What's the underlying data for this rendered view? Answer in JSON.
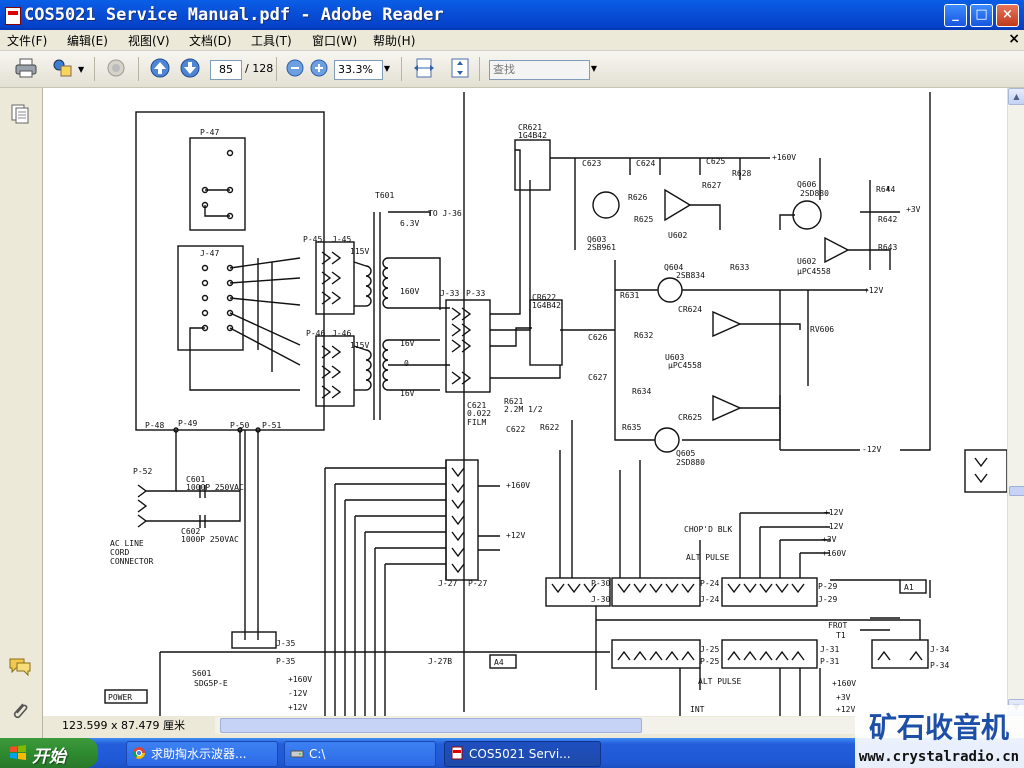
{
  "window": {
    "title": "COS5021 Service Manual.pdf - Adobe Reader",
    "buttons": {
      "minimize": "_",
      "maximize": "□",
      "close": "×"
    }
  },
  "menubar": {
    "items": [
      "文件(F)",
      "编辑(E)",
      "视图(V)",
      "文档(D)",
      "工具(T)",
      "窗口(W)",
      "帮助(H)"
    ],
    "close": "×"
  },
  "toolbar": {
    "page_current": "85",
    "page_total": "/ 128",
    "zoom": "33.3%",
    "find_placeholder": "查找"
  },
  "status": {
    "page_size": "123.599 x 87.479 厘米"
  },
  "schematic": {
    "labels": {
      "p47": "P-47",
      "j47": "J-47",
      "t601": "T601",
      "to_j36": "TO J-36",
      "v63": "6.3V",
      "p45": "P-45",
      "j45": "J-45",
      "p46": "P-46",
      "j46": "J-46",
      "v115a": "115V",
      "v115b": "115V",
      "v160": "160V",
      "v16a": "16V",
      "v0": "0",
      "v16b": "16V",
      "p48": "P-48",
      "p49": "P-49",
      "p50": "P-50",
      "p51": "P-51",
      "p52": "P-52",
      "c601": "C601",
      "c601v": "1000P 250VAC",
      "c602": "C602",
      "c602v": "1000P 250VAC",
      "acline": "AC LINE",
      "cord": "CORD",
      "connector": "CONNECTOR",
      "cr621": "CR621",
      "cr621v": "1G4B42",
      "cr622": "CR622",
      "cr622v": "1G4B42",
      "j33": "J-33",
      "p33": "P-33",
      "c621": "C621",
      "c621v": "0.022",
      "film": "FILM",
      "r621": "R621",
      "r621v": "2.2M 1/2",
      "c622": "C622",
      "r622": "R622",
      "c623": "C623",
      "c624": "C624",
      "c625": "C625",
      "plus160": "+160V",
      "r625": "R625",
      "r626": "R626",
      "r627": "R627",
      "r628": "R628",
      "q603": "Q603",
      "q603v": "2SB961",
      "u602": "U602",
      "u602v": "μPC4558",
      "q604": "Q604",
      "q604v": "2SB834",
      "q605": "Q605",
      "q605v": "2SD880",
      "q606": "Q606",
      "q606v": "2SD880",
      "u603": "U603",
      "u603v": "μPC4558",
      "r631": "R631",
      "r632": "R632",
      "r633": "R633",
      "r634": "R634",
      "r635": "R635",
      "c626": "C626",
      "c627": "C627",
      "cr624": "CR624",
      "cr625": "CR625",
      "plus12": "+12V",
      "minus12": "-12V",
      "plus3": "+3V",
      "r642": "R642",
      "r643": "R643",
      "r644": "R644",
      "rv606": "RV606",
      "j27": "J-27",
      "p27": "P-27",
      "p30": "P-30",
      "j30": "J-30",
      "p24": "P-24",
      "j24": "J-24",
      "p29": "P-29",
      "j29": "J-29",
      "p25": "P-25",
      "j25": "J-25",
      "j31": "J-31",
      "p31": "P-31",
      "j34": "J-34",
      "p34": "P-34",
      "j35": "J-35",
      "p35": "P-35",
      "j27b": "J-27B",
      "a4": "A4",
      "a1": "A1",
      "s601": "S601",
      "s601v": "SDG5P-E",
      "power": "POWER",
      "chopd": "CHOP'D BLK",
      "altpulse": "ALT PULSE",
      "altpulse2": "ALT PULSE",
      "int": "INT",
      "frot": "FROT",
      "t1": "T1"
    }
  },
  "taskbar": {
    "start": "开始",
    "tasks": [
      {
        "label": "求助掏水示波器...",
        "active": false
      },
      {
        "label": "C:\\",
        "active": false
      },
      {
        "label": "COS5021 Servi...",
        "active": true
      }
    ],
    "watermark_title": "矿石收音机",
    "watermark_url": "www.crystalradio.cn"
  }
}
